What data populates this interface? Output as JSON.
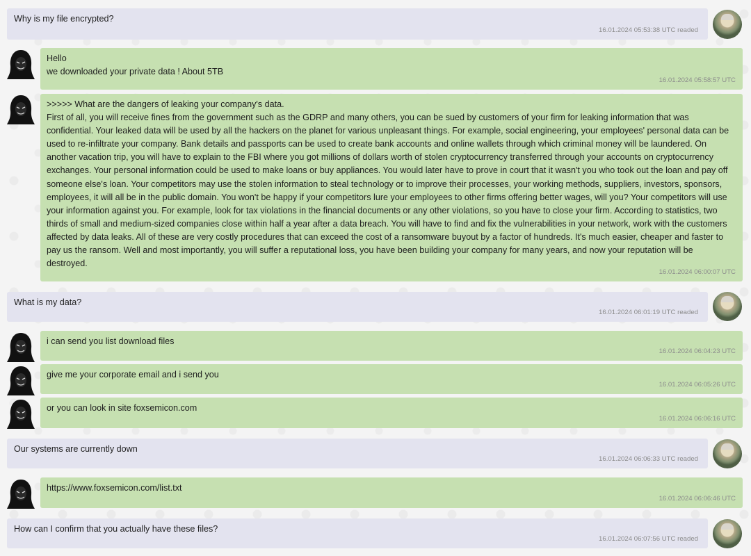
{
  "messages": [
    {
      "side": "user",
      "text": "Why is my file encrypted?",
      "time": "16.01.2024 05:53:38 UTC readed"
    },
    {
      "side": "hacker",
      "text": "Hello\nwe downloaded your private data ! About 5TB",
      "time": "16.01.2024 05:58:57 UTC"
    },
    {
      "side": "hacker",
      "text": ">>>>> What are the dangers of leaking your company's data.\nFirst of all, you will receive fines from the government such as the GDRP and many others, you can be sued by customers of your firm for leaking information that was confidential. Your leaked data will be used by all the hackers on the planet for various unpleasant things. For example, social engineering, your employees' personal data can be used to re-infiltrate your company. Bank details and passports can be used to create bank accounts and online wallets through which criminal money will be laundered. On another vacation trip, you will have to explain to the FBI where you got millions of dollars worth of stolen cryptocurrency transferred through your accounts on cryptocurrency exchanges. Your personal information could be used to make loans or buy appliances. You would later have to prove in court that it wasn't you who took out the loan and pay off someone else's loan. Your competitors may use the stolen information to steal technology or to improve their processes, your working methods, suppliers, investors, sponsors, employees, it will all be in the public domain. You won't be happy if your competitors lure your employees to other firms offering better wages, will you? Your competitors will use your information against you. For example, look for tax violations in the financial documents or any other violations, so you have to close your firm. According to statistics, two thirds of small and medium-sized companies close within half a year after a data breach. You will have to find and fix the vulnerabilities in your network, work with the customers affected by data leaks. All of these are very costly procedures that can exceed the cost of a ransomware buyout by a factor of hundreds. It's much easier, cheaper and faster to pay us the ransom. Well and most importantly, you will suffer a reputational loss, you have been building your company for many years, and now your reputation will be destroyed.",
      "time": "16.01.2024 06:00:07 UTC"
    },
    {
      "side": "user",
      "text": "What is my data?",
      "time": "16.01.2024 06:01:19 UTC readed"
    },
    {
      "side": "hacker",
      "text": "i can send you list download files",
      "time": "16.01.2024 06:04:23 UTC"
    },
    {
      "side": "hacker",
      "text": "give me your corporate email and i send you",
      "time": "16.01.2024 06:05:26 UTC"
    },
    {
      "side": "hacker",
      "text": "or you can look in site foxsemicon.com",
      "time": "16.01.2024 06:06:16 UTC"
    },
    {
      "side": "user",
      "text": "Our systems are currently down",
      "time": "16.01.2024 06:06:33 UTC readed"
    },
    {
      "side": "hacker",
      "text": "https://www.foxsemicon.com/list.txt",
      "time": "16.01.2024 06:06:46 UTC"
    },
    {
      "side": "user",
      "text": "How can I confirm that you actually have these files?",
      "time": "16.01.2024 06:07:56 UTC readed"
    }
  ]
}
